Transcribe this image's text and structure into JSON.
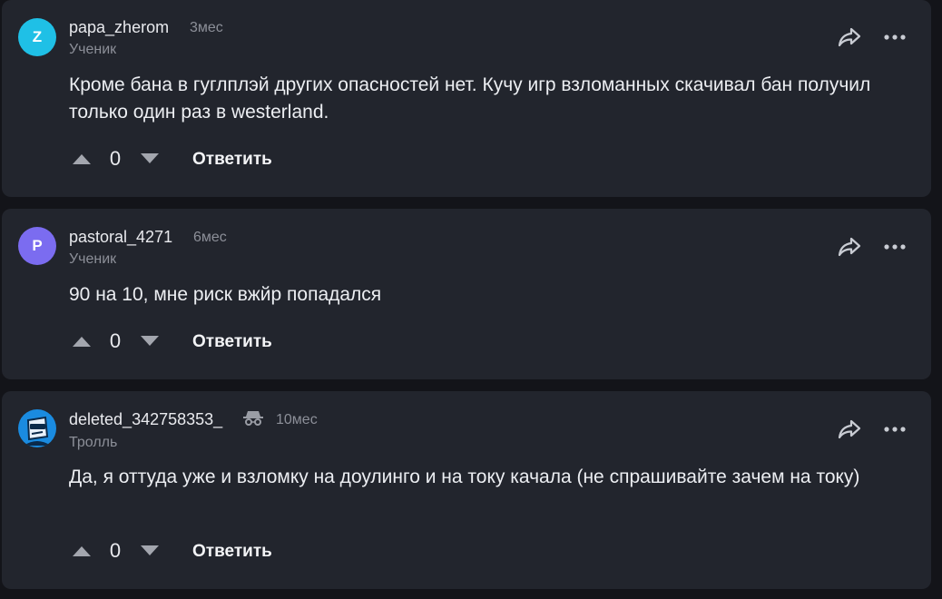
{
  "colors": {
    "background": "#131419",
    "card": "#22252d",
    "muted": "#8c8f98"
  },
  "comments": [
    {
      "avatar_letter": "Z",
      "avatar_color": "#1fc0e6",
      "username": "papa_zherom",
      "time": "3мес",
      "rank": "Ученик",
      "text": "Кроме бана в гуглплэй других опасностей нет. Кучу игр взломанных скачивал бан получил только один раз в westerland.",
      "votes": "0",
      "reply_label": "Ответить"
    },
    {
      "avatar_letter": "P",
      "avatar_color": "#7b6cf0",
      "username": "pastoral_4271",
      "time": "6мес",
      "rank": "Ученик",
      "text": "90 на 10, мне риск вжйр попадался",
      "votes": "0",
      "reply_label": "Ответить"
    },
    {
      "avatar_icon": "mascot-avatar-icon",
      "username": "deleted_342758353_",
      "badge_icon": "incognito-spy-icon",
      "time": "10мес",
      "rank": "Тролль",
      "text": "Да, я оттуда уже и взломку на доулинго и на току качала (не спрашивайте зачем на току)",
      "votes": "0",
      "reply_label": "Ответить"
    }
  ]
}
